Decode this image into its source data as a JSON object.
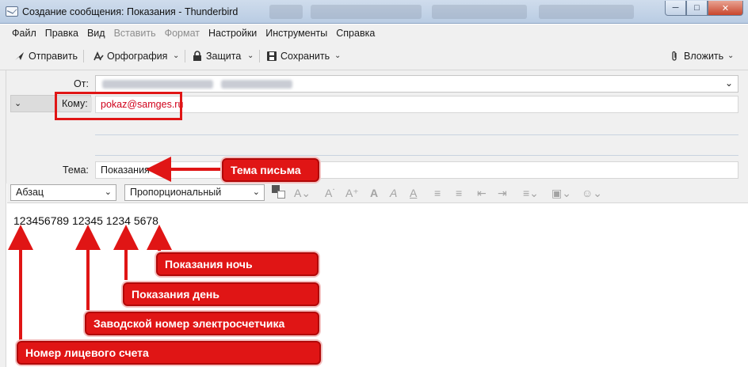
{
  "window": {
    "title": "Создание сообщения: Показания - Thunderbird",
    "controls": {
      "minimize": "─",
      "maximize": "□",
      "close": "✕"
    }
  },
  "menu": [
    "Файл",
    "Правка",
    "Вид",
    "Вставить",
    "Формат",
    "Настройки",
    "Инструменты",
    "Справка"
  ],
  "menu_disabled": [
    "Вставить",
    "Формат"
  ],
  "toolbar": {
    "send": "Отправить",
    "spelling": "Орфография",
    "security": "Защита",
    "save": "Сохранить",
    "attach": "Вложить"
  },
  "headers": {
    "from_label": "От:",
    "to_label": "Кому:",
    "to_value": "pokaz@samges.ru",
    "subject_label": "Тема:",
    "subject_value": "Показания"
  },
  "format": {
    "paragraph": "Абзац",
    "font": "Пропорциональный"
  },
  "body": {
    "text": "123456789 12345 1234 5678"
  },
  "annotations": {
    "subject": "Тема письма",
    "night": "Показания ночь",
    "day": "Показания день",
    "meter": "Заводской номер электросчетчика",
    "account": "Номер лицевого счета"
  },
  "colors": {
    "annotation_red": "#e01515",
    "address_red": "#d0021b"
  }
}
